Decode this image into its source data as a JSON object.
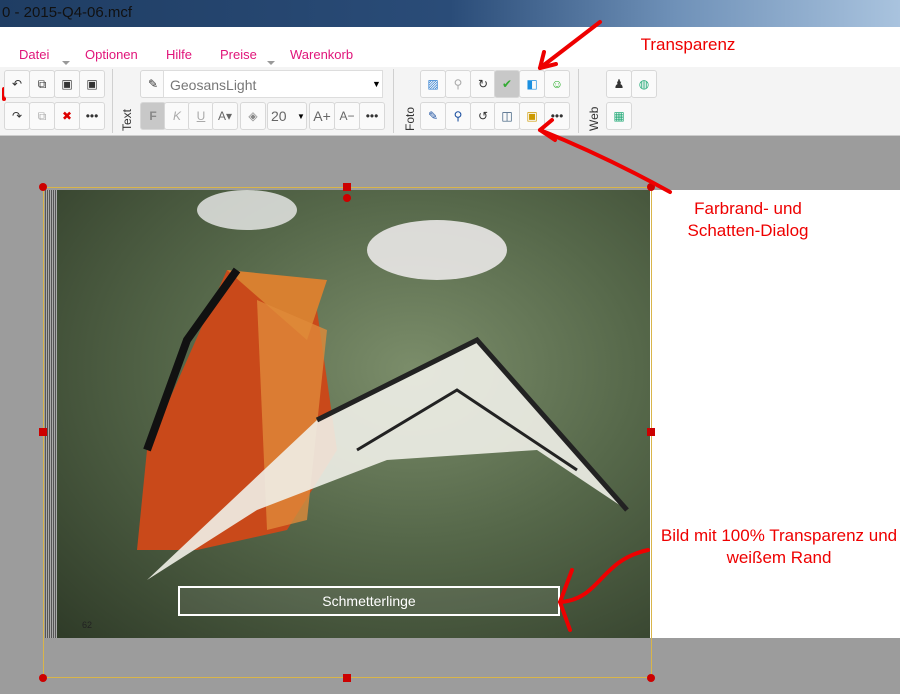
{
  "window": {
    "title": "0 - 2015-Q4-06.mcf"
  },
  "menu": [
    "Datei",
    "Optionen",
    "Hilfe",
    "Preise",
    "Warenkorb"
  ],
  "toolbar": {
    "text_group_label": "Text",
    "foto_group_label": "Foto",
    "web_group_label": "Web",
    "font_name": "GeosansLight",
    "font_size": "20",
    "bold": "F",
    "italic": "K",
    "underline": "U",
    "more": "•••",
    "grow": "A+",
    "shrink": "A−"
  },
  "canvas": {
    "caption": "Schmetterlinge",
    "page_number": "62"
  },
  "annotations": {
    "transparency": "Transparenz",
    "dialog": "Farbrand- und Schatten-Dialog",
    "image_note": "Bild mit 100% Transparenz und weißem Rand"
  },
  "colors": {
    "menu": "#e0157a",
    "annotation": "#ee0000",
    "selection": "#d9b54a"
  }
}
